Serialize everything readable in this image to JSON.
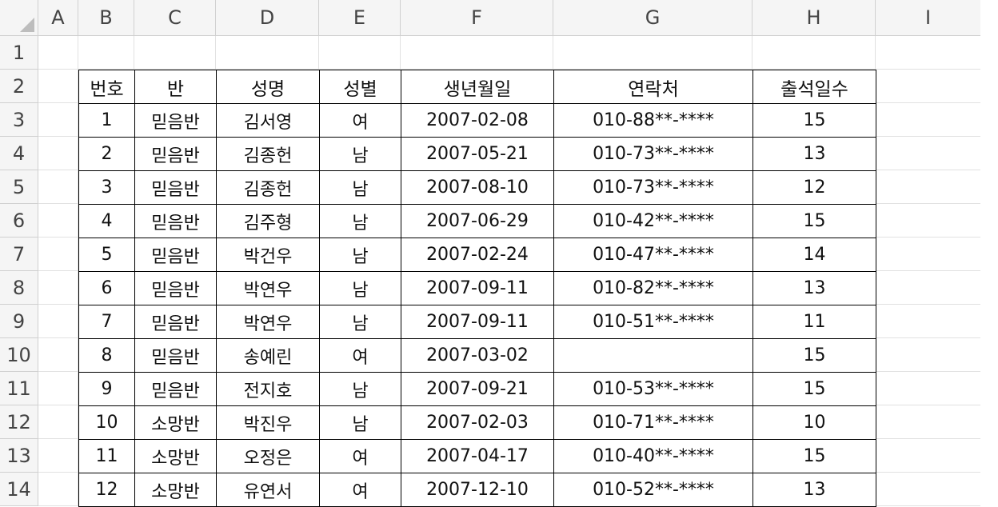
{
  "columns": [
    "A",
    "B",
    "C",
    "D",
    "E",
    "F",
    "G",
    "H",
    "I"
  ],
  "rows": [
    "1",
    "2",
    "3",
    "4",
    "5",
    "6",
    "7",
    "8",
    "9",
    "10",
    "11",
    "12",
    "13",
    "14"
  ],
  "table": {
    "headers": [
      "번호",
      "반",
      "성명",
      "성별",
      "생년월일",
      "연락처",
      "출석일수"
    ],
    "records": [
      [
        "1",
        "믿음반",
        "김서영",
        "여",
        "2007-02-08",
        "010-88**-****",
        "15"
      ],
      [
        "2",
        "믿음반",
        "김종헌",
        "남",
        "2007-05-21",
        "010-73**-****",
        "13"
      ],
      [
        "3",
        "믿음반",
        "김종헌",
        "남",
        "2007-08-10",
        "010-73**-****",
        "12"
      ],
      [
        "4",
        "믿음반",
        "김주형",
        "남",
        "2007-06-29",
        "010-42**-****",
        "15"
      ],
      [
        "5",
        "믿음반",
        "박건우",
        "남",
        "2007-02-24",
        "010-47**-****",
        "14"
      ],
      [
        "6",
        "믿음반",
        "박연우",
        "남",
        "2007-09-11",
        "010-82**-****",
        "13"
      ],
      [
        "7",
        "믿음반",
        "박연우",
        "남",
        "2007-09-11",
        "010-51**-****",
        "11"
      ],
      [
        "8",
        "믿음반",
        "송예린",
        "여",
        "2007-03-02",
        "",
        "15"
      ],
      [
        "9",
        "믿음반",
        "전지호",
        "남",
        "2007-09-21",
        "010-53**-****",
        "15"
      ],
      [
        "10",
        "소망반",
        "박진우",
        "남",
        "2007-02-03",
        "010-71**-****",
        "10"
      ],
      [
        "11",
        "소망반",
        "오정은",
        "여",
        "2007-04-17",
        "010-40**-****",
        "15"
      ],
      [
        "12",
        "소망반",
        "유연서",
        "여",
        "2007-12-10",
        "010-52**-****",
        "13"
      ]
    ]
  }
}
